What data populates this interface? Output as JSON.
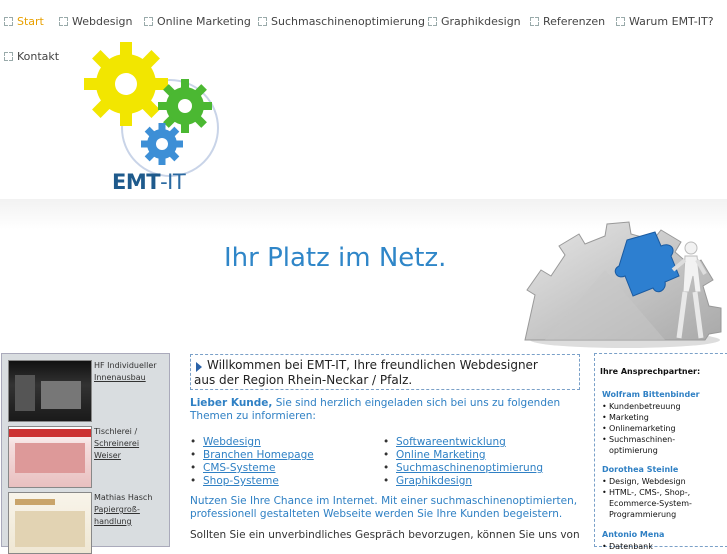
{
  "nav": {
    "items": [
      {
        "label": "Start",
        "active": true
      },
      {
        "label": "Webdesign"
      },
      {
        "label": "Online Marketing"
      },
      {
        "label": "Suchmaschinenoptimierung"
      },
      {
        "label": "Graphikdesign"
      },
      {
        "label": "Referenzen"
      },
      {
        "label": "Warum EMT-IT?"
      },
      {
        "label": "Kontakt"
      }
    ]
  },
  "logo": {
    "text_main": "EMT",
    "text_suffix": "-IT"
  },
  "banner": {
    "slogan": "Ihr Platz im Netz."
  },
  "references": [
    {
      "title": "HF Individueller",
      "link": "Innenausbau"
    },
    {
      "title": "Tischlerei /",
      "link1": "Schreinerei",
      "link2": "Weiser"
    },
    {
      "title": "Mathias Hasch",
      "link1": "Papiergroß-",
      "link2": "handlung"
    }
  ],
  "main": {
    "welcome_line1": "Willkommen bei EMT-IT, Ihre freundlichen Webdesigner",
    "welcome_line2": "aus der Region Rhein-Neckar / Pfalz.",
    "intro_bold": "Lieber Kunde,",
    "intro_rest": " Sie sind herzlich eingeladen sich bei uns zu folgenden Themen zu informieren:",
    "links_left": [
      "Webdesign",
      "Branchen Homepage",
      "CMS-Systeme",
      "Shop-Systeme"
    ],
    "links_right": [
      "Softwareentwicklung",
      "Online Marketing",
      "Suchmaschinenoptimierung",
      "Graphikdesign"
    ],
    "paragraph2": "Nutzen Sie Ihre Chance im Internet. Mit einer suchmaschinenoptimierten, professionell gestalteten Webseite werden Sie Ihre Kunden begeistern.",
    "paragraph3": "Sollten Sie ein unverbindliches Gespräch bevorzugen, können Sie uns von"
  },
  "contacts": {
    "title": "Ihre Ansprechpartner:",
    "people": [
      {
        "name": "Wolfram Bittenbinder",
        "items": [
          "Kundenbetreuung",
          "Marketing",
          "Onlinemarketing",
          "Suchmaschinen-optimierung"
        ]
      },
      {
        "name": "Dorothea Steinle",
        "items": [
          "Design, Webdesign",
          "HTML-, CMS-, Shop-, Ecommerce-System-Programmierung"
        ]
      },
      {
        "name": "Antonio Mena",
        "items": [
          "Datenbank"
        ]
      }
    ]
  },
  "colors": {
    "accent_blue": "#2f80c4",
    "nav_active": "#e8a000",
    "logo_blue": "#1e5a8c",
    "gear_yellow": "#f2e600",
    "gear_green": "#4bb832",
    "gear_blue": "#3d8fd6"
  }
}
